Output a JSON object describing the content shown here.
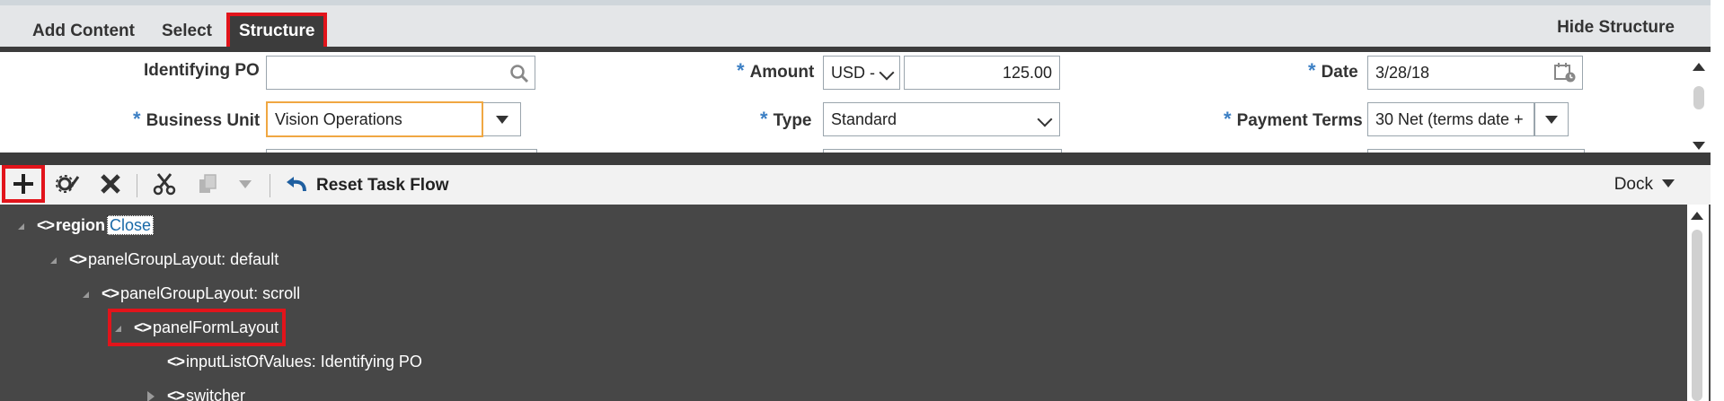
{
  "tabs": {
    "add_content": "Add Content",
    "select": "Select",
    "structure": "Structure",
    "hide_structure": "Hide Structure"
  },
  "form": {
    "identifying_po": {
      "label": "Identifying PO",
      "value": "",
      "icon": "search-icon"
    },
    "amount": {
      "label": "Amount",
      "currency": "USD -",
      "value": "125.00",
      "required": "*"
    },
    "date": {
      "label": "Date",
      "value": "3/28/18",
      "icon": "calendar-icon",
      "required": "*"
    },
    "business_unit": {
      "label": "Business Unit",
      "value": "Vision Operations",
      "required": "*"
    },
    "type": {
      "label": "Type",
      "value": "Standard",
      "required": "*"
    },
    "payment_terms": {
      "label": "Payment Terms",
      "value": "30 Net (terms date +",
      "required": "*"
    }
  },
  "toolbar": {
    "icons": [
      "add-icon",
      "edit-icon",
      "delete-icon",
      "cut-icon",
      "copy-icon",
      "dropdown-icon",
      "reset-icon"
    ],
    "reset_label": "Reset Task Flow",
    "dock_label": "Dock"
  },
  "tree": {
    "nodes": [
      {
        "tag": "<>",
        "label": "region",
        "link": "Close"
      },
      {
        "tag": "<>",
        "label": "panelGroupLayout: default"
      },
      {
        "tag": "<>",
        "label": "panelGroupLayout: scroll"
      },
      {
        "tag": "<>",
        "label": "panelFormLayout"
      },
      {
        "tag": "<>",
        "label": "inputListOfValues: Identifying PO"
      },
      {
        "tag": "<>",
        "label": "switcher"
      }
    ]
  },
  "colors": {
    "highlight": "#e2141b",
    "dark_bar": "#3c3c3c",
    "tree_bg": "#474747",
    "focus_border": "#f0a742",
    "required_star": "#3b7fc4"
  }
}
